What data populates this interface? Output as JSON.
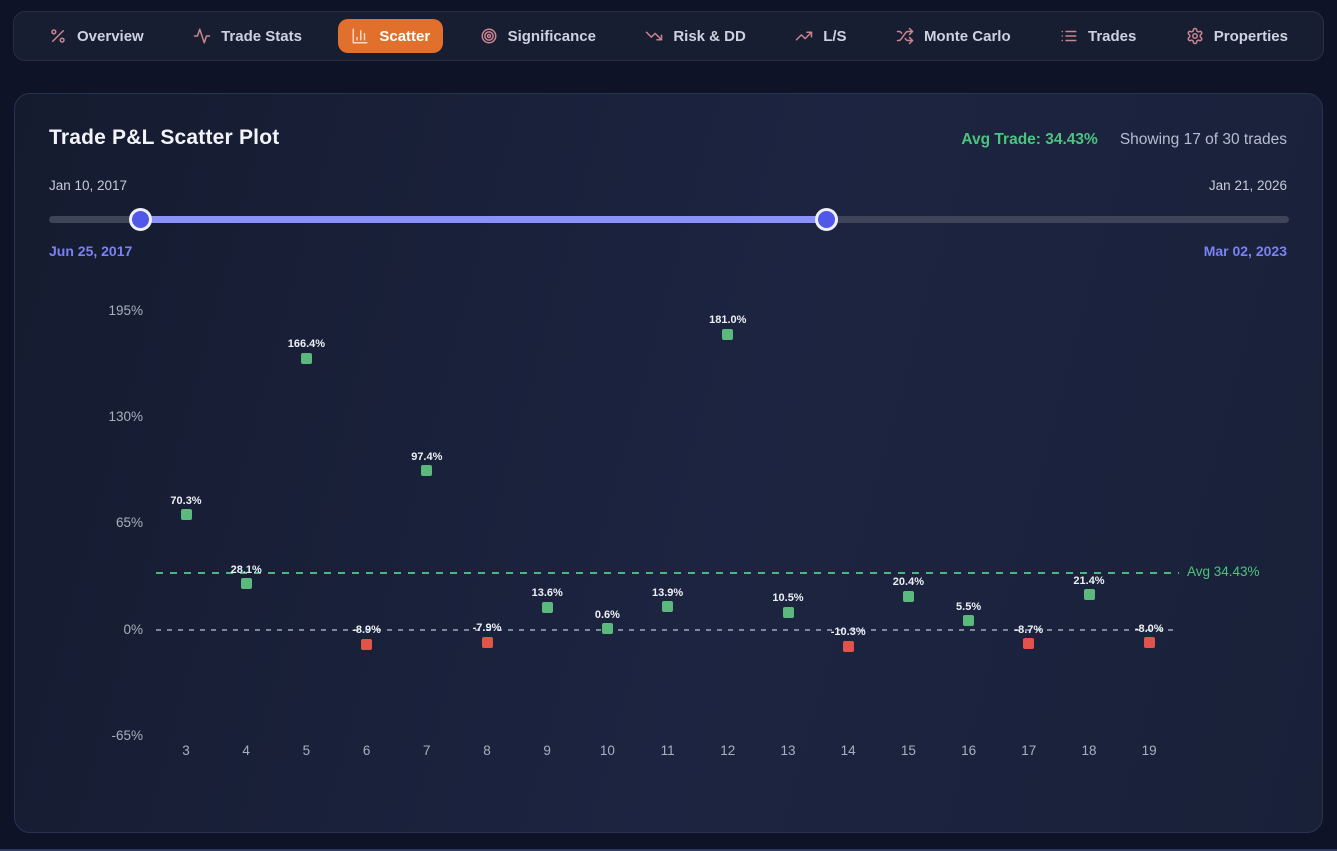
{
  "nav": {
    "tabs": [
      {
        "label": "Overview",
        "icon": "percent-icon",
        "active": false
      },
      {
        "label": "Trade Stats",
        "icon": "activity-icon",
        "active": false
      },
      {
        "label": "Scatter",
        "icon": "bar-chart-icon",
        "active": true
      },
      {
        "label": "Significance",
        "icon": "target-icon",
        "active": false
      },
      {
        "label": "Risk & DD",
        "icon": "trending-down-icon",
        "active": false
      },
      {
        "label": "L/S",
        "icon": "trending-up-icon",
        "active": false
      },
      {
        "label": "Monte Carlo",
        "icon": "shuffle-icon",
        "active": false
      },
      {
        "label": "Trades",
        "icon": "list-icon",
        "active": false
      },
      {
        "label": "Properties",
        "icon": "gear-icon",
        "active": false
      }
    ],
    "active_bg": "#e0702c"
  },
  "panel": {
    "title": "Trade P&L Scatter Plot",
    "avg_trade": "Avg Trade: 34.43%",
    "showing": "Showing 17 of 30 trades"
  },
  "slider": {
    "min_label": "Jan 10, 2017",
    "max_label": "Jan 21, 2026",
    "start_label": "Jun 25, 2017",
    "end_label": "Mar 02, 2023",
    "start_pct": 7.4,
    "end_pct": 62.7,
    "track_color": "#3e4558",
    "active_color": "#8b92f7",
    "handle_color": "#5157e8"
  },
  "chart_data": {
    "type": "scatter",
    "title": "Trade P&L Scatter Plot",
    "points": [
      {
        "x": 3,
        "value": 70.3,
        "label": "70.3%"
      },
      {
        "x": 4,
        "value": 28.1,
        "label": "28.1%"
      },
      {
        "x": 5,
        "value": 166.4,
        "label": "166.4%"
      },
      {
        "x": 6,
        "value": -8.9,
        "label": "-8.9%"
      },
      {
        "x": 7,
        "value": 97.4,
        "label": "97.4%"
      },
      {
        "x": 8,
        "value": -7.9,
        "label": "-7.9%"
      },
      {
        "x": 9,
        "value": 13.6,
        "label": "13.6%"
      },
      {
        "x": 10,
        "value": 0.6,
        "label": "0.6%"
      },
      {
        "x": 11,
        "value": 13.9,
        "label": "13.9%"
      },
      {
        "x": 12,
        "value": 181.0,
        "label": "181.0%"
      },
      {
        "x": 13,
        "value": 10.5,
        "label": "10.5%"
      },
      {
        "x": 14,
        "value": -10.3,
        "label": "-10.3%"
      },
      {
        "x": 15,
        "value": 20.4,
        "label": "20.4%"
      },
      {
        "x": 16,
        "value": 5.5,
        "label": "5.5%"
      },
      {
        "x": 17,
        "value": -8.7,
        "label": "-8.7%"
      },
      {
        "x": 18,
        "value": 21.4,
        "label": "21.4%"
      },
      {
        "x": 19,
        "value": -8.0,
        "label": "-8.0%"
      }
    ],
    "y_ticks": [
      {
        "value": 195,
        "label": "195%"
      },
      {
        "value": 130,
        "label": "130%"
      },
      {
        "value": 65,
        "label": "65%"
      },
      {
        "value": 0,
        "label": "0%"
      },
      {
        "value": -65,
        "label": "-65%"
      }
    ],
    "x_ticks": [
      3,
      4,
      5,
      6,
      7,
      8,
      9,
      10,
      11,
      12,
      13,
      14,
      15,
      16,
      17,
      18,
      19
    ],
    "avg": {
      "value": 34.43,
      "label": "Avg 34.43%"
    },
    "zero_line": true,
    "ylim": [
      -97.5,
      227.5
    ],
    "legend": "none",
    "grid": "off",
    "colors": {
      "win": "#5cb97e",
      "loss": "#e2544a",
      "avg_line": "#4db580",
      "avg_text": "#4cc47e",
      "zero_line": "#98a1b3"
    }
  }
}
